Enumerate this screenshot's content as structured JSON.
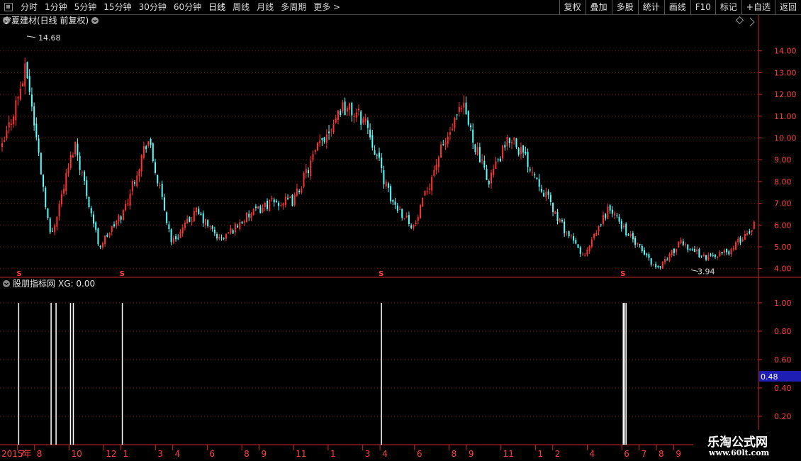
{
  "toolbar": {
    "periods": [
      "分时",
      "1分钟",
      "5分钟",
      "15分钟",
      "30分钟",
      "60分钟",
      "日线",
      "周线",
      "月线",
      "多周期",
      "更多 >"
    ],
    "active_period": "日线",
    "right_buttons": [
      "复权",
      "叠加",
      "多股",
      "统计",
      "画线",
      "F10",
      "标记",
      "+自选",
      "返回"
    ]
  },
  "main_panel": {
    "title": "宁夏建材(日线 前复权)",
    "max_label": "14.68",
    "min_label": "3.94",
    "signal_markers": [
      "S",
      "S",
      "S",
      "S"
    ]
  },
  "indicator_panel": {
    "title": "股朋指标网",
    "value_text": "XG: 0.00",
    "current_badge": "0.48"
  },
  "x_axis": {
    "year_label": "2015年",
    "month_labels": [
      "7",
      "8",
      "10",
      "12",
      "1",
      "3",
      "4",
      "6",
      "8",
      "9",
      "11",
      "1",
      "3",
      "4",
      "6",
      "8",
      "9",
      "11",
      "1",
      "2",
      "4",
      "6",
      "7",
      "8",
      "9"
    ]
  },
  "watermark": {
    "title": "乐淘公式网",
    "url": "www.60lt.com"
  },
  "colors": {
    "background": "#000000",
    "up_candle": "#ff3232",
    "down_candle": "#54ffff",
    "axis_red": "#c82828",
    "label_red": "#ff4040",
    "signal_line": "#ffffff",
    "badge_bg": "#1e1eb4"
  },
  "chart_data": [
    {
      "type": "candlestick",
      "title": "宁夏建材(日线 前复权)",
      "y_ticks": [
        4.0,
        5.0,
        6.0,
        7.0,
        8.0,
        9.0,
        10.0,
        11.0,
        12.0,
        13.0,
        14.0
      ],
      "ylim": [
        3.6,
        15.0
      ],
      "high": 14.68,
      "low": 3.94,
      "close_path": [
        {
          "m": "2015-06",
          "v": 9.5
        },
        {
          "m": "2015-07",
          "v": 13.2
        },
        {
          "m": "2015-07",
          "v": 5.4
        },
        {
          "m": "2015-08",
          "v": 9.8
        },
        {
          "m": "2015-09",
          "v": 5.0
        },
        {
          "m": "2015-10",
          "v": 6.6
        },
        {
          "m": "2015-12",
          "v": 10.0
        },
        {
          "m": "2016-01",
          "v": 5.2
        },
        {
          "m": "2016-03",
          "v": 6.6
        },
        {
          "m": "2016-04",
          "v": 5.3
        },
        {
          "m": "2016-06",
          "v": 6.3
        },
        {
          "m": "2016-08",
          "v": 7.0
        },
        {
          "m": "2016-09",
          "v": 7.1
        },
        {
          "m": "2016-11",
          "v": 9.5
        },
        {
          "m": "2016-12",
          "v": 11.5
        },
        {
          "m": "2017-01",
          "v": 10.8
        },
        {
          "m": "2017-03",
          "v": 7.2
        },
        {
          "m": "2017-04",
          "v": 5.9
        },
        {
          "m": "2017-06",
          "v": 9.2
        },
        {
          "m": "2017-08",
          "v": 11.4
        },
        {
          "m": "2017-09",
          "v": 8.0
        },
        {
          "m": "2017-11",
          "v": 10.1
        },
        {
          "m": "2018-01",
          "v": 8.3
        },
        {
          "m": "2018-02",
          "v": 6.1
        },
        {
          "m": "2018-04",
          "v": 4.5
        },
        {
          "m": "2018-06",
          "v": 6.8
        },
        {
          "m": "2018-07",
          "v": 5.3
        },
        {
          "m": "2018-08",
          "v": 4.0
        },
        {
          "m": "2018-09",
          "v": 5.2
        },
        {
          "m": "2018-10",
          "v": 4.5
        },
        {
          "m": "2018-12",
          "v": 4.8
        },
        {
          "m": "2019-01",
          "v": 6.0
        }
      ]
    },
    {
      "type": "bar",
      "title": "股朋指标网",
      "y_ticks": [
        0.2,
        0.4,
        0.6,
        0.8,
        1.0
      ],
      "ylim": [
        0,
        1.08
      ],
      "current_value": 0.48,
      "signal_values": [
        1.0,
        1.0,
        1.0,
        1.0,
        1.0,
        1.0,
        1.0,
        1.0,
        1.0,
        1.0
      ],
      "signal_months": [
        "2015-07",
        "2015-09",
        "2015-09",
        "2015-10",
        "2015-10",
        "2016-01",
        "2017-04",
        "2018-06",
        "2018-06",
        "2018-06"
      ]
    }
  ]
}
